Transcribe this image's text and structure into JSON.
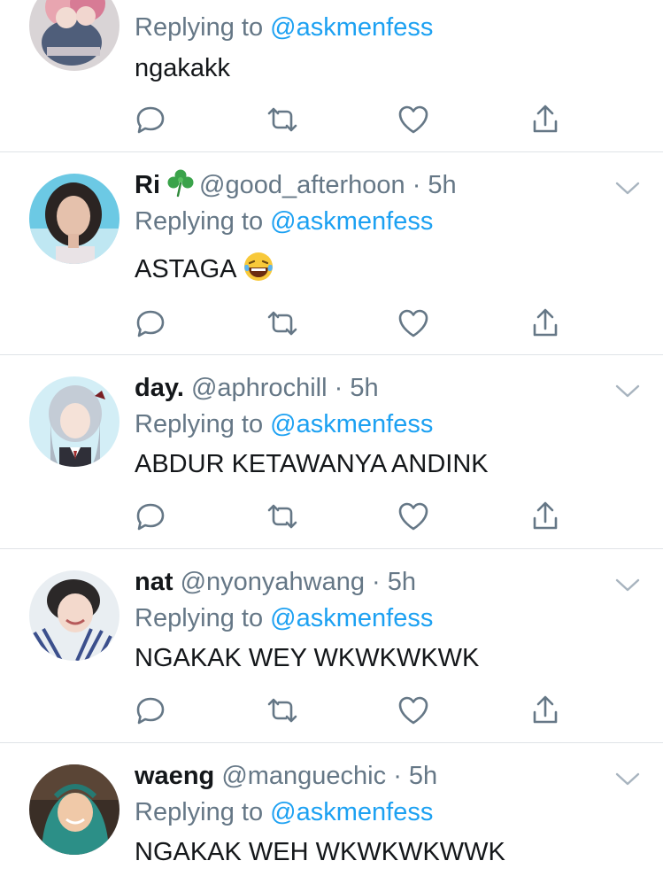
{
  "tweets": [
    {
      "display_name": "",
      "handle": "",
      "time": "",
      "replying_prefix": "Replying to",
      "replying_to": "@askmenfess",
      "text": "ngakakk",
      "avatar": "anime-couple-avatar"
    },
    {
      "display_name": "Ri",
      "name_emoji": "clover-icon",
      "handle": "@good_afterhoon",
      "separator": "·",
      "time": "5h",
      "replying_prefix": "Replying to",
      "replying_to": "@askmenfess",
      "text": "ASTAGA",
      "text_emoji": "laughing-tears-emoji",
      "avatar": "girl-bob-hair-avatar"
    },
    {
      "display_name": "day.",
      "handle": "@aphrochill",
      "separator": "·",
      "time": "5h",
      "replying_prefix": "Replying to",
      "replying_to": "@askmenfess",
      "text": "ABDUR KETAWANYA ANDINK",
      "avatar": "anime-silver-hair-avatar"
    },
    {
      "display_name": "nat",
      "handle": "@nyonyahwang",
      "separator": "·",
      "time": "5h",
      "replying_prefix": "Replying to",
      "replying_to": "@askmenfess",
      "text": "NGAKAK WEY WKWKWKWK",
      "avatar": "smiling-boy-avatar"
    },
    {
      "display_name": "waeng",
      "handle": "@manguechic",
      "separator": "·",
      "time": "5h",
      "replying_prefix": "Replying to",
      "replying_to": "@askmenfess",
      "text": "NGAKAK WEH WKWKWKWWK",
      "avatar": "teal-hoodie-avatar"
    }
  ],
  "action_icons": [
    "reply-icon",
    "retweet-icon",
    "like-icon",
    "share-icon"
  ],
  "colors": {
    "text": "#14171a",
    "secondary": "#657786",
    "mention": "#1da1f2",
    "divider": "#dfe3e7"
  }
}
